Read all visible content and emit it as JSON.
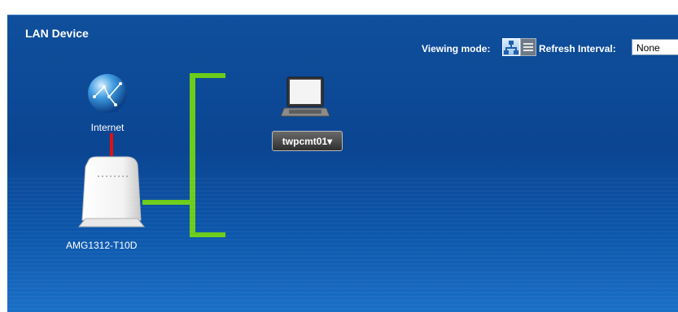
{
  "panel": {
    "title": "LAN Device"
  },
  "toolbar": {
    "viewing_mode_label": "Viewing mode:",
    "refresh_label": "Refresh Interval:",
    "refresh_value": "None",
    "view_modes": [
      "topology-icon",
      "list-icon"
    ],
    "selected_view_mode": "topology-icon"
  },
  "topology": {
    "internet_label": "Internet",
    "router_label": "AMG1312-T10D",
    "devices": [
      {
        "name": "twpcmt01",
        "icon": "laptop-icon"
      }
    ],
    "colors": {
      "wan_link": "#e01010",
      "lan_link": "#6ccc1a",
      "background": "#0b4592"
    }
  }
}
